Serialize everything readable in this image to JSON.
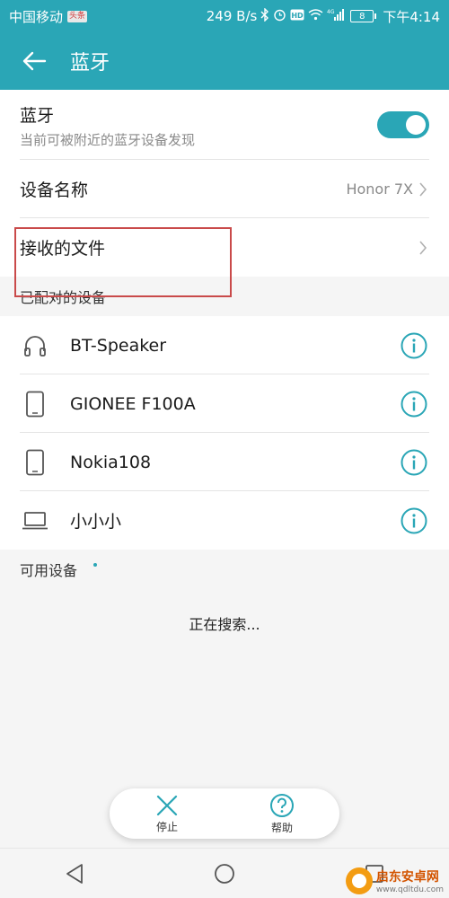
{
  "status_bar": {
    "carrier": "中国移动",
    "carrier_badge": "头条",
    "speed": "249 B/s",
    "network": "4G",
    "battery": "8",
    "time": "下午4:14"
  },
  "app_bar": {
    "title": "蓝牙",
    "back_icon": "arrow-left-icon"
  },
  "bluetooth": {
    "title": "蓝牙",
    "subtitle": "当前可被附近的蓝牙设备发现",
    "enabled": true,
    "accent": "#2aa6b6"
  },
  "device_name": {
    "label": "设备名称",
    "value": "Honor 7X"
  },
  "received_files": {
    "label": "接收的文件"
  },
  "paired_section": {
    "title": "已配对的设备",
    "devices": [
      {
        "name": "BT-Speaker",
        "icon": "headset-icon"
      },
      {
        "name": "GIONEE F100A",
        "icon": "phone-icon"
      },
      {
        "name": "Nokia108",
        "icon": "phone-icon"
      },
      {
        "name": "小小小",
        "icon": "laptop-icon"
      }
    ]
  },
  "available_section": {
    "title": "可用设备",
    "status": "正在搜索..."
  },
  "float_bar": {
    "stop_label": "停止",
    "help_label": "帮助"
  },
  "watermark": {
    "title": "启东安卓网",
    "url": "www.qdltdu.com"
  }
}
